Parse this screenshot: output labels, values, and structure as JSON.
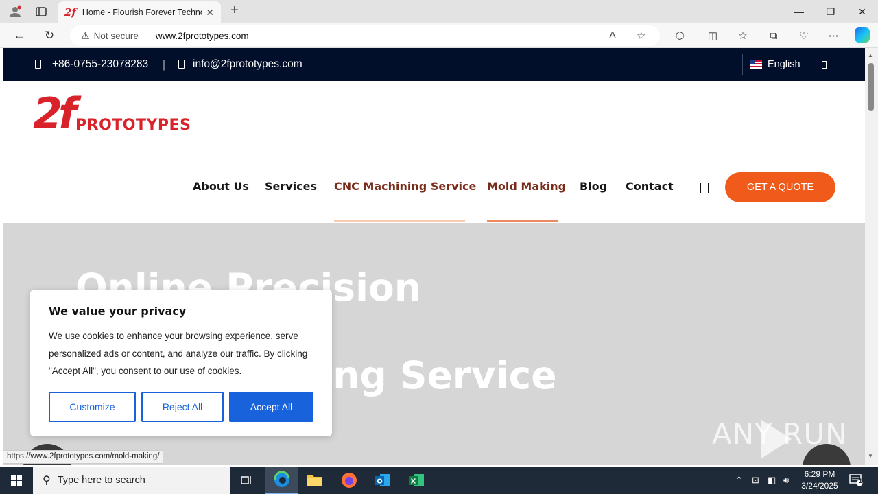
{
  "browser": {
    "tab_title": "Home - Flourish Forever Technol",
    "tab_favicon": "2f",
    "new_tab": "+",
    "security_label": "Not secure",
    "url": "www.2fprototypes.com",
    "status_url": "https://www.2fprototypes.com/mold-making/"
  },
  "topbar": {
    "phone": "+86-0755-23078283",
    "divider": "|",
    "email": "info@2fprototypes.com",
    "language": "English"
  },
  "logo": {
    "mark": "2f",
    "wordmark": "PROTOTYPES",
    "color": "#d8232a"
  },
  "nav": {
    "items": [
      "About Us",
      "Services",
      "CNC Machining Service",
      "Mold Making",
      "Blog",
      "Contact"
    ],
    "quote_button": "GET A QUOTE",
    "accent": "#f05a1a"
  },
  "hero": {
    "title_line1": "Online Precision Machining",
    "title_line2": "Manufacturing Service"
  },
  "cookie": {
    "title": "We value your privacy",
    "body": "We use cookies to enhance your browsing experience, serve personalized ads or content, and analyze our traffic. By clicking \"Accept All\", you consent to our use of cookies.",
    "customize": "Customize",
    "reject": "Reject All",
    "accept": "Accept All",
    "accent": "#1863dc"
  },
  "watermark": {
    "text": "ANY RUN"
  },
  "taskbar": {
    "search_placeholder": "Type here to search",
    "time": "6:29 PM",
    "date": "3/24/2025",
    "notification_count": "1"
  }
}
